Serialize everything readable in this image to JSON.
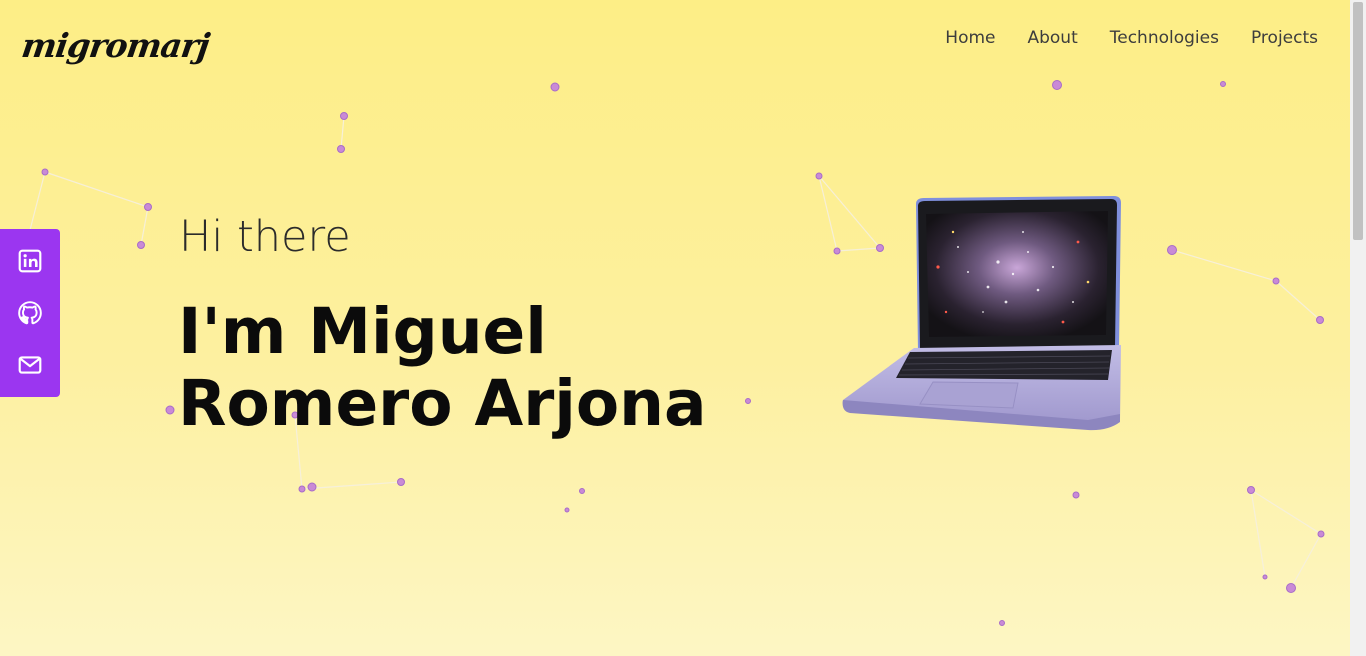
{
  "header": {
    "logo": "migromarj",
    "nav": [
      "Home",
      "About",
      "Technologies",
      "Projects"
    ]
  },
  "social": [
    {
      "icon": "linkedin-icon"
    },
    {
      "icon": "github-icon"
    },
    {
      "icon": "mail-icon"
    }
  ],
  "hero": {
    "greeting": "Hi there",
    "name_line1": "I'm Miguel",
    "name_line2": "Romero Arjona"
  },
  "colors": {
    "background": "#fdee86",
    "accent": "#9b36f0",
    "particles": "#c98ad6",
    "laptop": "#b3acdc"
  }
}
